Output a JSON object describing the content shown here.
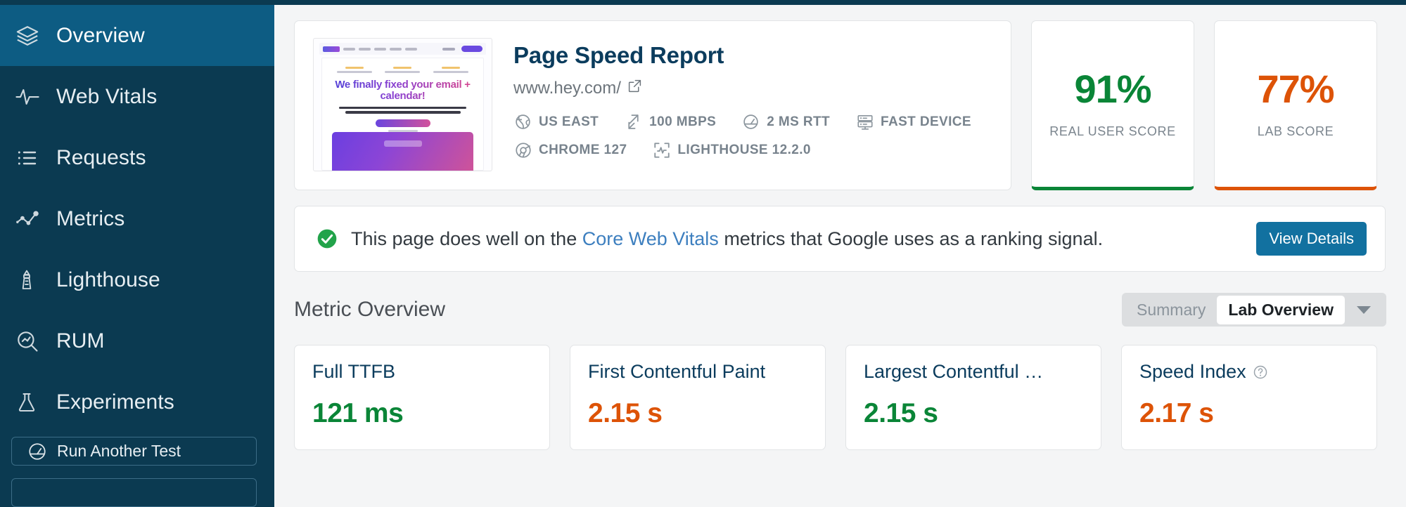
{
  "colors": {
    "sidebar_bg": "#0b3a51",
    "sidebar_active": "#0d5c83",
    "good": "#0a8537",
    "warn": "#dd5307",
    "accent": "#1271a0",
    "link": "#3d7fbf",
    "title": "#0b3c5d"
  },
  "sidebar": {
    "items": [
      {
        "label": "Overview",
        "icon": "layers-icon",
        "active": true
      },
      {
        "label": "Web Vitals",
        "icon": "pulse-icon",
        "active": false
      },
      {
        "label": "Requests",
        "icon": "list-icon",
        "active": false
      },
      {
        "label": "Metrics",
        "icon": "scatter-icon",
        "active": false
      },
      {
        "label": "Lighthouse",
        "icon": "lighthouse-icon",
        "active": false
      },
      {
        "label": "RUM",
        "icon": "search-chart-icon",
        "active": false
      },
      {
        "label": "Experiments",
        "icon": "flask-icon",
        "active": false
      }
    ],
    "buttons": [
      {
        "label": "Run Another Test",
        "icon": "gauge-icon"
      }
    ]
  },
  "report": {
    "title": "Page Speed Report",
    "url": "www.hey.com/",
    "external_link_icon": "external-link-icon",
    "thumbnail_headline": "We finally fixed your email + calendar!",
    "meta": [
      {
        "label": "US EAST",
        "icon": "globe-icon"
      },
      {
        "label": "100 MBPS",
        "icon": "bandwidth-icon"
      },
      {
        "label": "2 MS RTT",
        "icon": "latency-icon"
      },
      {
        "label": "FAST DEVICE",
        "icon": "server-icon"
      },
      {
        "label": "CHROME 127",
        "icon": "chrome-icon"
      },
      {
        "label": "LIGHTHOUSE 12.2.0",
        "icon": "lighthouse-scan-icon"
      }
    ]
  },
  "scores": [
    {
      "value": "91%",
      "label": "REAL USER SCORE",
      "color": "#0a8537"
    },
    {
      "value": "77%",
      "label": "LAB SCORE",
      "color": "#dd5307"
    }
  ],
  "banner": {
    "icon": "check-circle-icon",
    "text_before": "This page does well on the ",
    "link_text": "Core Web Vitals",
    "text_after": " metrics that Google uses as a ranking signal.",
    "button_label": "View Details"
  },
  "metric_overview": {
    "title": "Metric Overview",
    "segment_label": "Summary",
    "selected_option": "Lab Overview",
    "caret_icon": "chevron-down-icon"
  },
  "metrics": [
    {
      "name": "Full TTFB",
      "value": "121 ms",
      "color": "#0a8537",
      "help": false
    },
    {
      "name": "First Contentful Paint",
      "value": "2.15 s",
      "color": "#dd5307",
      "help": false
    },
    {
      "name": "Largest Contentful …",
      "value": "2.15 s",
      "color": "#0a8537",
      "help": false
    },
    {
      "name": "Speed Index",
      "value": "2.17 s",
      "color": "#dd5307",
      "help": true
    }
  ]
}
